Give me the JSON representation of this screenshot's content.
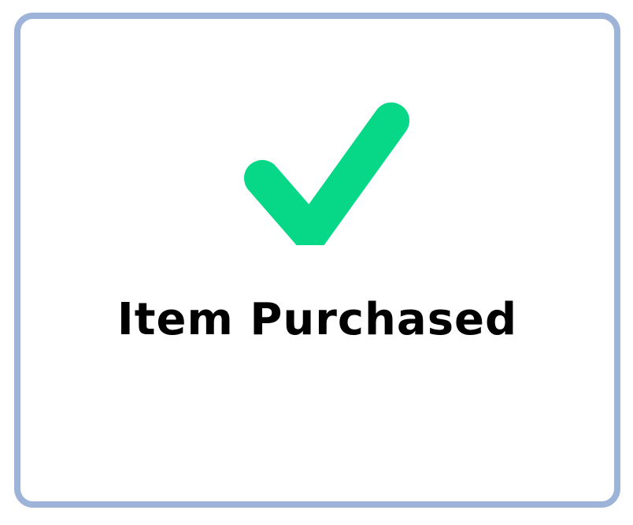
{
  "dialog": {
    "icon": "checkmark-icon",
    "icon_color": "#06d888",
    "border_color": "#9db3d8",
    "title": "Item Purchased"
  }
}
